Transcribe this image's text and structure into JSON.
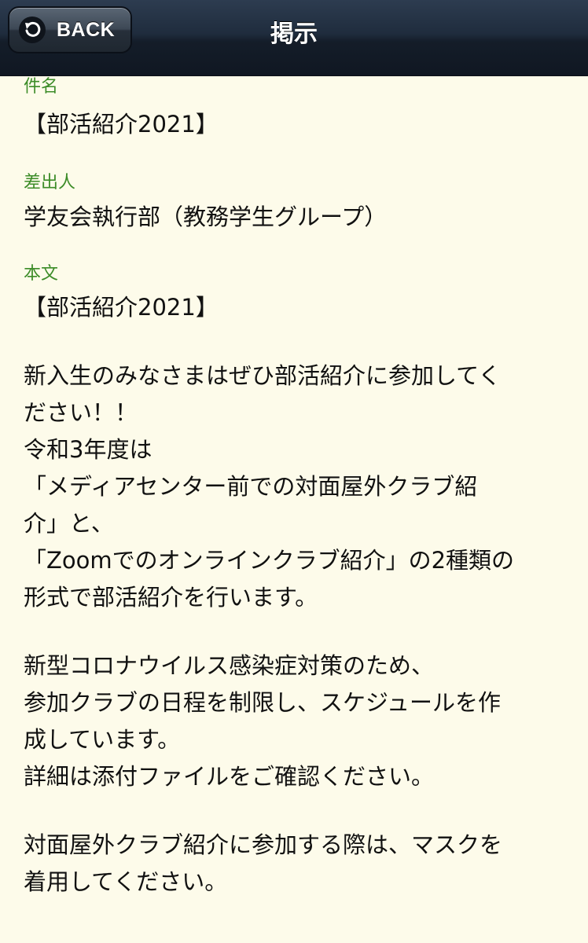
{
  "header": {
    "back_label": "BACK",
    "title": "掲示"
  },
  "message": {
    "subject_label": "件名",
    "subject_value": "【部活紹介2021】",
    "sender_label": "差出人",
    "sender_value": "学友会執行部（教務学生グループ）",
    "body_label": "本文",
    "body_paragraphs": [
      "【部活紹介2021】",
      "新入生のみなさまはぜひ部活紹介に参加してく\nださい！！\n令和3年度は\n「メディアセンター前での対面屋外クラブ紹\n介」と、\n「Zoomでのオンラインクラブ紹介」の2種類の\n形式で部活紹介を行います。",
      "新型コロナウイルス感染症対策のため、\n参加クラブの日程を制限し、スケジュールを作\n成しています。\n詳細は添付ファイルをご確認ください。",
      "対面屋外クラブ紹介に参加する際は、マスクを\n着用してください。"
    ]
  }
}
